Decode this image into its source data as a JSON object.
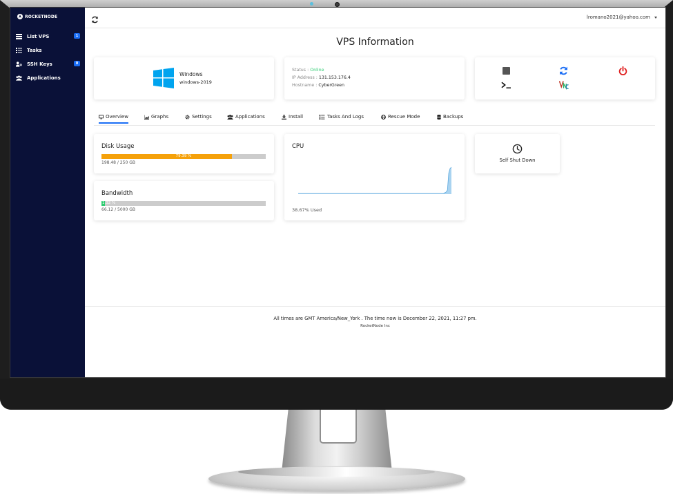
{
  "app": {
    "brand": "ROCKETNODE"
  },
  "sidebar": {
    "items": [
      {
        "label": "List VPS",
        "badge": "1",
        "icon": "list-icon"
      },
      {
        "label": "Tasks",
        "icon": "tasks-icon"
      },
      {
        "label": "SSH Keys",
        "badge": "0",
        "icon": "user-key-icon"
      },
      {
        "label": "Applications",
        "icon": "applications-icon"
      }
    ]
  },
  "topbar": {
    "user_email": "lromano2021@yahoo.com"
  },
  "page": {
    "title": "VPS Information"
  },
  "os": {
    "name": "Windows",
    "version": "windows-2019",
    "logo_color": "#00a4ef"
  },
  "status": {
    "status_label": "Status :",
    "status_value": "Online",
    "ip_label": "IP Address :",
    "ip_value": "131.153.176.4",
    "hostname_label": "Hostname :",
    "hostname_value": "CyberGreen",
    "online_color": "#2ecc71"
  },
  "actions": [
    {
      "name": "stop-icon",
      "color": "#555555"
    },
    {
      "name": "restart-icon",
      "color": "#1a6df5"
    },
    {
      "name": "power-icon",
      "color": "#e02020"
    },
    {
      "name": "console-icon",
      "color": "#111111"
    },
    {
      "name": "vnc-icon",
      "color": "#c0392b"
    }
  ],
  "tabs": [
    {
      "label": "Overview",
      "icon": "monitor-icon",
      "active": true
    },
    {
      "label": "Graphs",
      "icon": "chart-icon"
    },
    {
      "label": "Settings",
      "icon": "gear-icon"
    },
    {
      "label": "Applications",
      "icon": "applications-icon"
    },
    {
      "label": "Install",
      "icon": "download-icon"
    },
    {
      "label": "Tasks And Logs",
      "icon": "tasks-icon"
    },
    {
      "label": "Rescue Mode",
      "icon": "globe-icon"
    },
    {
      "label": "Backups",
      "icon": "database-icon"
    }
  ],
  "disk": {
    "label": "Disk Usage",
    "percent_text": "79.39 %",
    "percent": 79.39,
    "detail": "198.48 / 250 GB",
    "bar_color": "#f5a10a"
  },
  "bandwidth": {
    "label": "Bandwidth",
    "percent_text": "1.32 %",
    "percent": 1.32,
    "detail": "66.12 / 5000 GB",
    "bar_color": "#2ecc71"
  },
  "cpu": {
    "label": "CPU",
    "used": "38.67% Used",
    "fill_color": "#a9d3f0",
    "line_color": "#5ba8de",
    "samples": [
      0,
      0,
      0,
      0,
      0,
      0,
      0,
      0,
      0,
      0,
      0,
      0,
      0,
      0,
      0,
      0,
      0,
      0,
      0,
      0,
      0,
      0,
      0,
      0,
      0,
      0,
      0,
      0,
      0,
      0,
      0,
      0,
      0,
      0,
      0,
      0,
      0,
      0,
      0,
      0,
      0,
      0,
      0,
      0,
      0,
      0,
      0,
      0,
      0,
      0,
      0,
      0,
      0,
      0,
      0,
      0,
      0,
      0,
      0,
      0,
      0,
      0,
      0,
      0,
      0,
      0,
      0,
      0,
      0,
      0,
      0,
      0,
      0,
      0,
      0,
      0,
      0,
      0,
      0,
      0,
      0,
      0,
      0,
      0,
      0,
      0,
      0,
      0,
      0,
      0,
      0,
      0,
      0,
      0,
      0,
      0,
      0,
      0,
      0,
      0,
      0,
      0,
      0,
      0,
      0,
      0,
      0,
      0,
      0,
      0,
      1,
      2,
      5,
      30,
      37,
      38.67
    ]
  },
  "shutdown": {
    "label": "Self Shut Down"
  },
  "footer": {
    "time_note": "All times are GMT America/New_York . The time now is December 22, 2021, 11:27 pm.",
    "company": "RocketNode Inc"
  }
}
